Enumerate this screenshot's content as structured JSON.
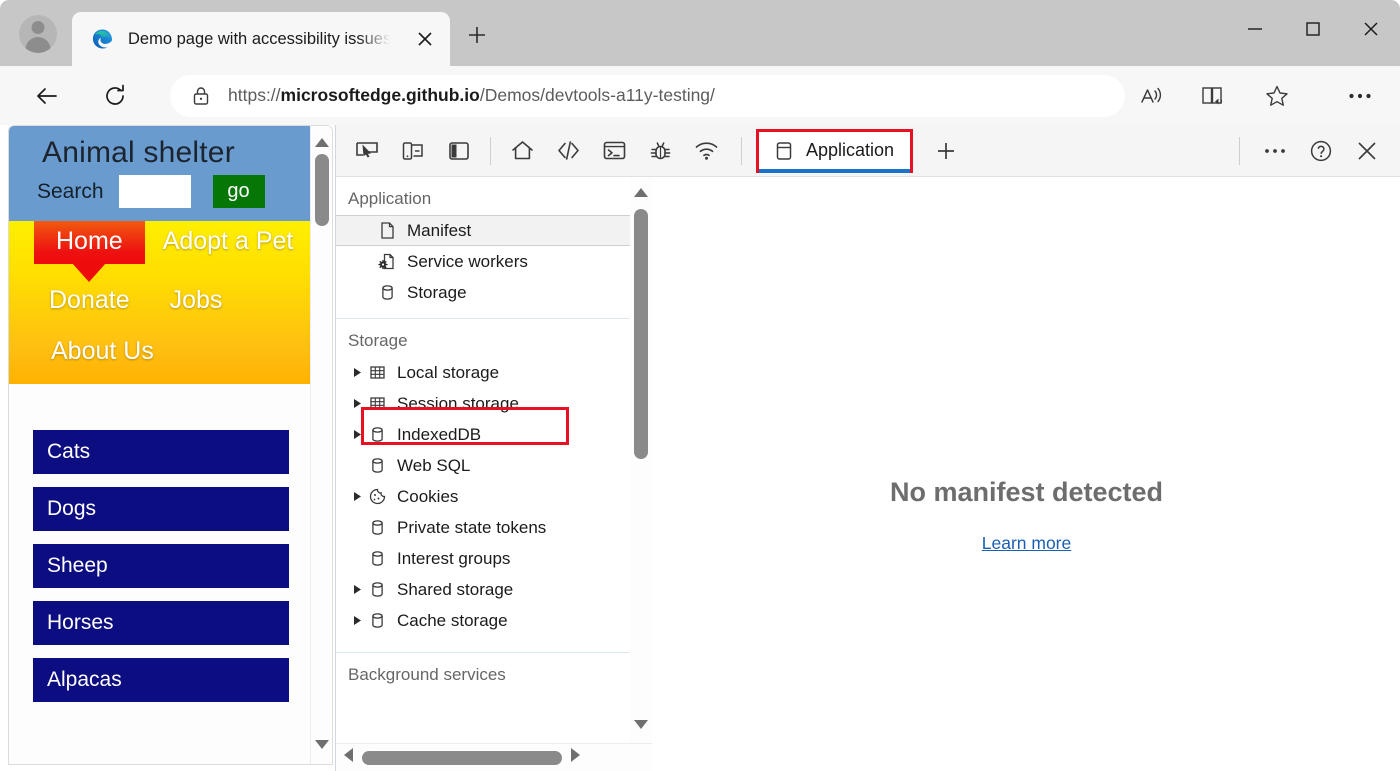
{
  "window": {
    "tab": {
      "title": "Demo page with accessibility issues",
      "favicon": "edge-logo-icon",
      "close": "close-tab-icon"
    },
    "new_tab_label": "+",
    "controls": {
      "minimize": "minimize-icon",
      "maximize": "maximize-icon",
      "close": "close-window-icon"
    },
    "avatar": "profile-avatar-icon"
  },
  "browser_toolbar": {
    "back": "back-arrow-icon",
    "reload": "reload-icon",
    "lock": "lock-icon",
    "url_prefix": "https://",
    "url_domain": "microsoftedge.github.io",
    "url_path": "/Demos/devtools-a11y-testing/",
    "url_full": "https://microsoftedge.github.io/Demos/devtools-a11y-testing/",
    "read_aloud": "read-aloud-icon",
    "immersive_reader": "immersive-reader-icon",
    "favorites": "favorites-star-icon",
    "settings_more": "more-options-icon"
  },
  "page": {
    "site_title": "Animal shelter",
    "search_label": "Search",
    "search_value": "",
    "search_placeholder": "",
    "go_button": "go",
    "nav": [
      {
        "label": "Home",
        "active": true
      },
      {
        "label": "Adopt a Pet",
        "active": false
      },
      {
        "label": "Donate",
        "active": false
      },
      {
        "label": "Jobs",
        "active": false
      },
      {
        "label": "About Us",
        "active": false
      }
    ],
    "categories": [
      "Cats",
      "Dogs",
      "Sheep",
      "Horses",
      "Alpacas"
    ],
    "colors": {
      "header_bg": "#6a9bce",
      "nav_gradient_start": "#ffef00",
      "nav_gradient_end": "#ffb200",
      "home_tab": "#ed0b0b",
      "go_button": "#067706",
      "category_btn": "#0d0d82"
    }
  },
  "devtools": {
    "toolbar_icons": [
      {
        "name": "inspect-element-icon"
      },
      {
        "name": "device-emulation-icon"
      },
      {
        "name": "dock-side-icon"
      },
      {
        "name": "welcome-home-icon"
      },
      {
        "name": "elements-icon"
      },
      {
        "name": "console-icon"
      },
      {
        "name": "sources-debugger-icon"
      },
      {
        "name": "network-icon"
      }
    ],
    "active_tab": {
      "label": "Application",
      "icon": "application-storage-icon",
      "highlighted": true,
      "highlight_color": "#e81123",
      "underline_color": "#1a73c8"
    },
    "add_tab": "+",
    "right_controls": {
      "more": "more-tools-icon",
      "help": "help-icon",
      "close": "close-devtools-icon"
    },
    "sidebar": {
      "sections": [
        {
          "title": "Application",
          "items": [
            {
              "label": "Manifest",
              "icon": "manifest-document-icon",
              "expandable": false,
              "selected": true,
              "highlighted": true
            },
            {
              "label": "Service workers",
              "icon": "service-worker-icon",
              "expandable": false,
              "selected": false
            },
            {
              "label": "Storage",
              "icon": "storage-database-icon",
              "expandable": false,
              "selected": false
            }
          ]
        },
        {
          "title": "Storage",
          "items": [
            {
              "label": "Local storage",
              "icon": "table-grid-icon",
              "expandable": true
            },
            {
              "label": "Session storage",
              "icon": "table-grid-icon",
              "expandable": true
            },
            {
              "label": "IndexedDB",
              "icon": "storage-database-icon",
              "expandable": true
            },
            {
              "label": "Web SQL",
              "icon": "storage-database-icon",
              "expandable": false
            },
            {
              "label": "Cookies",
              "icon": "cookie-icon",
              "expandable": true
            },
            {
              "label": "Private state tokens",
              "icon": "storage-database-icon",
              "expandable": false
            },
            {
              "label": "Interest groups",
              "icon": "storage-database-icon",
              "expandable": false
            },
            {
              "label": "Shared storage",
              "icon": "storage-database-icon",
              "expandable": true
            },
            {
              "label": "Cache storage",
              "icon": "storage-database-icon",
              "expandable": true
            }
          ]
        },
        {
          "title": "Background services",
          "items": []
        }
      ]
    },
    "main_panel": {
      "empty_title": "No manifest detected",
      "learn_more": "Learn more"
    }
  }
}
